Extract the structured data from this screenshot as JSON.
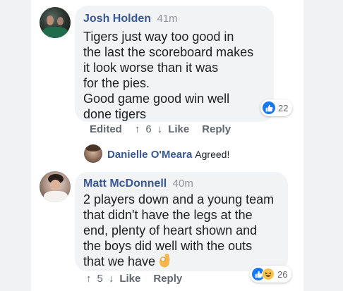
{
  "comments": [
    {
      "author": "Josh Holden",
      "time": "41m",
      "text": "Tigers just way too good in\nthe last the scoreboard makes\nit look worse than it was\nfor the pies.\nGood game good win well\ndone tigers",
      "reactions": {
        "count": "22",
        "types": [
          "like"
        ]
      },
      "actions": {
        "edited": "Edited",
        "up_count": "6",
        "like": "Like",
        "reply": "Reply"
      }
    },
    {
      "author": "Matt McDonnell",
      "time": "40m",
      "text": "2 players down and a young team\nthat didn't have the legs at the\nend, plenty of heart shown and\nthe boys did well with the outs\nthat we have",
      "emoji": "ok-hand",
      "reactions": {
        "count": "26",
        "types": [
          "like",
          "haha"
        ]
      },
      "actions": {
        "up_count": "5",
        "like": "Like",
        "reply": "Reply"
      }
    }
  ],
  "reply": {
    "author": "Danielle O'Meara",
    "text": "Agreed!"
  },
  "colors": {
    "name": "#385898",
    "bubble": "#f2f3f5",
    "like": "#1877f2",
    "haha": "#f7c44a",
    "meta": "#606770"
  }
}
